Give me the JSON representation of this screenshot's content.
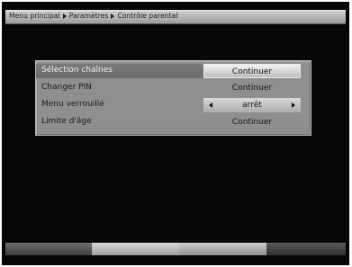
{
  "header": {
    "breadcrumb": [
      "Menu principal",
      "Paramètres",
      "Contrôle parental"
    ]
  },
  "menu": {
    "items": [
      {
        "label": "Sélection chaînes",
        "value": "Continuer",
        "selected": true,
        "choice": false
      },
      {
        "label": "Changer PIN",
        "value": "Continuer",
        "selected": false,
        "choice": false
      },
      {
        "label": "Menu verrouillé",
        "value": "arrêt",
        "selected": false,
        "choice": true
      },
      {
        "label": "Limite d'âge",
        "value": "Continuer",
        "selected": false,
        "choice": false
      }
    ]
  },
  "footer": {
    "buttons": [
      "red-key",
      "green-key",
      "yellow-key",
      "blue-key"
    ]
  },
  "icons": {
    "breadcrumb_separator": "triangle-right-icon",
    "value_left": "triangle-left-icon",
    "value_right": "triangle-right-icon"
  },
  "colors": {
    "background": "#050505",
    "panel": "#8e8e8e",
    "selected_value": "#f3f3f3",
    "header_bar": "#bdbdbd"
  }
}
